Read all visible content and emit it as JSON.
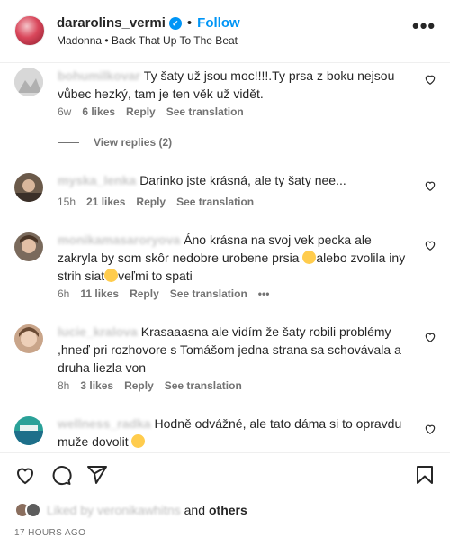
{
  "header": {
    "username": "dararolins_vermi",
    "separator": "•",
    "follow_label": "Follow",
    "audio": "Madonna • Back That Up To The Beat",
    "more_label": "•••"
  },
  "comments": [
    {
      "username": "bohumilkovar",
      "text": "Ty šaty už jsou moc!!!!.Ty prsa z boku nejsou vůbec hezký, tam je ten věk už vidět.",
      "time": "6w",
      "likes": "6 likes",
      "reply": "Reply",
      "translate": "See translation"
    },
    {
      "username": "myska_lenka",
      "text": "Darinko jste krásná, ale ty šaty nee...",
      "time": "15h",
      "likes": "21 likes",
      "reply": "Reply",
      "translate": "See translation"
    },
    {
      "username": "monikamasaroryova",
      "text_a": "Áno krásna na svoj vek pecka ale zakryla by som skôr nedobre urobene prsia ",
      "text_b": "alebo zvolila iny strih siat",
      "text_c": "veľmi to spati",
      "time": "6h",
      "likes": "11 likes",
      "reply": "Reply",
      "translate": "See translation",
      "more": "•••"
    },
    {
      "username": "lucie_kralova",
      "text": "Krasaaasna ale vidím že šaty robili problémy ,hneď pri rozhovore s Tomášom jedna strana sa schovávala a druha liezla von",
      "time": "8h",
      "likes": "3 likes",
      "reply": "Reply",
      "translate": "See translation"
    },
    {
      "username": "wellness_radka",
      "text": "Hodně odvážné, ale tato dáma si to opravdu muže dovolit ",
      "time": "",
      "likes": "",
      "reply": "",
      "translate": ""
    }
  ],
  "view_replies": "View replies (2)",
  "likes_line": {
    "liked_by": "Liked by veronikawhitns",
    "and": "and",
    "others": "others"
  },
  "timestamp": "17 HOURS AGO",
  "colors": {
    "accent": "#0095f6",
    "text": "#262626",
    "muted": "#737373"
  }
}
